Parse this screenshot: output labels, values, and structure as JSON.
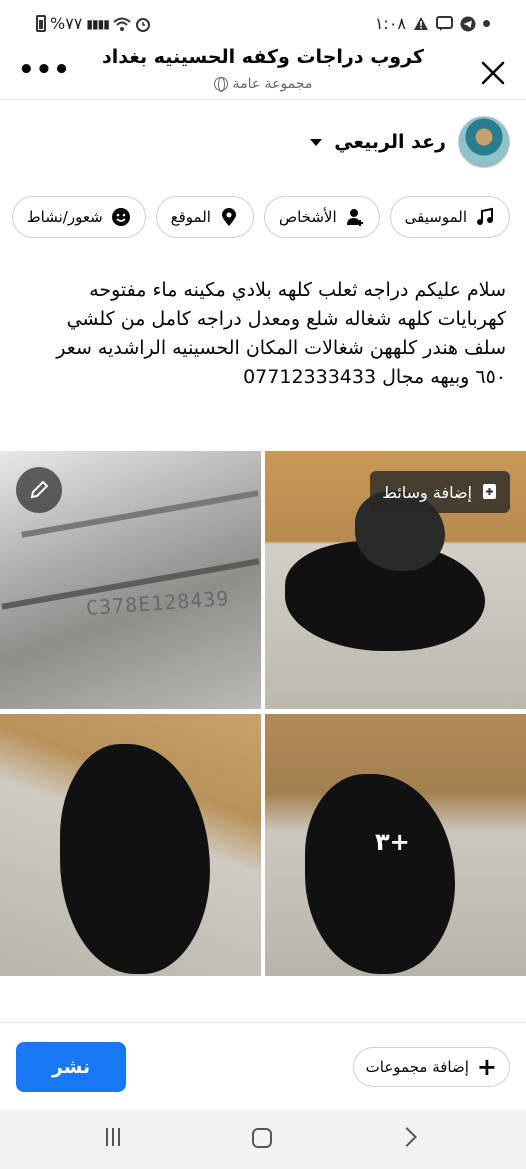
{
  "status_bar": {
    "time": "١:٠٨",
    "battery": "%٧٧",
    "icons": [
      "telegram-icon",
      "message-icon",
      "warning-icon",
      "alarm-icon",
      "wifi-icon",
      "signal-icon",
      "battery-icon"
    ]
  },
  "header": {
    "title": "كروب  دراجات وكفه الحسينيه بغداد",
    "subtitle": "مجموعة عامة",
    "close_icon": "close-icon",
    "more_icon": "more-icon",
    "more_label": "•••"
  },
  "author": {
    "name": "رعد الربيعي"
  },
  "chips": [
    {
      "label": "الموسيقى",
      "icon": "music-icon"
    },
    {
      "label": "الأشخاص",
      "icon": "people-icon"
    },
    {
      "label": "الموقع",
      "icon": "location-icon"
    },
    {
      "label": "شعور/نشاط",
      "icon": "emoji-icon"
    }
  ],
  "post": {
    "text": "سلام عليكم دراجه ثعلب  كلهه بلادي مكينه ماء مفتوحه كهربايات كلهه شغاله  شلع ومعدل دراجه كامل من كلشي سلف هندر كلههن شغالات المكان الحسينيه الراشديه سعر ٦٥٠ وبيهه مجال 07712333433"
  },
  "photos": {
    "serial_text": "C378E128439",
    "add_media_label": "إضافة وسائط",
    "more_count": "+٣"
  },
  "bottom": {
    "post_button": "نشر",
    "add_groups": "إضافة مجموعات"
  },
  "colors": {
    "accent": "#1877f2",
    "text": "#050505",
    "secondary": "#65676b",
    "border": "#ced0d4"
  }
}
